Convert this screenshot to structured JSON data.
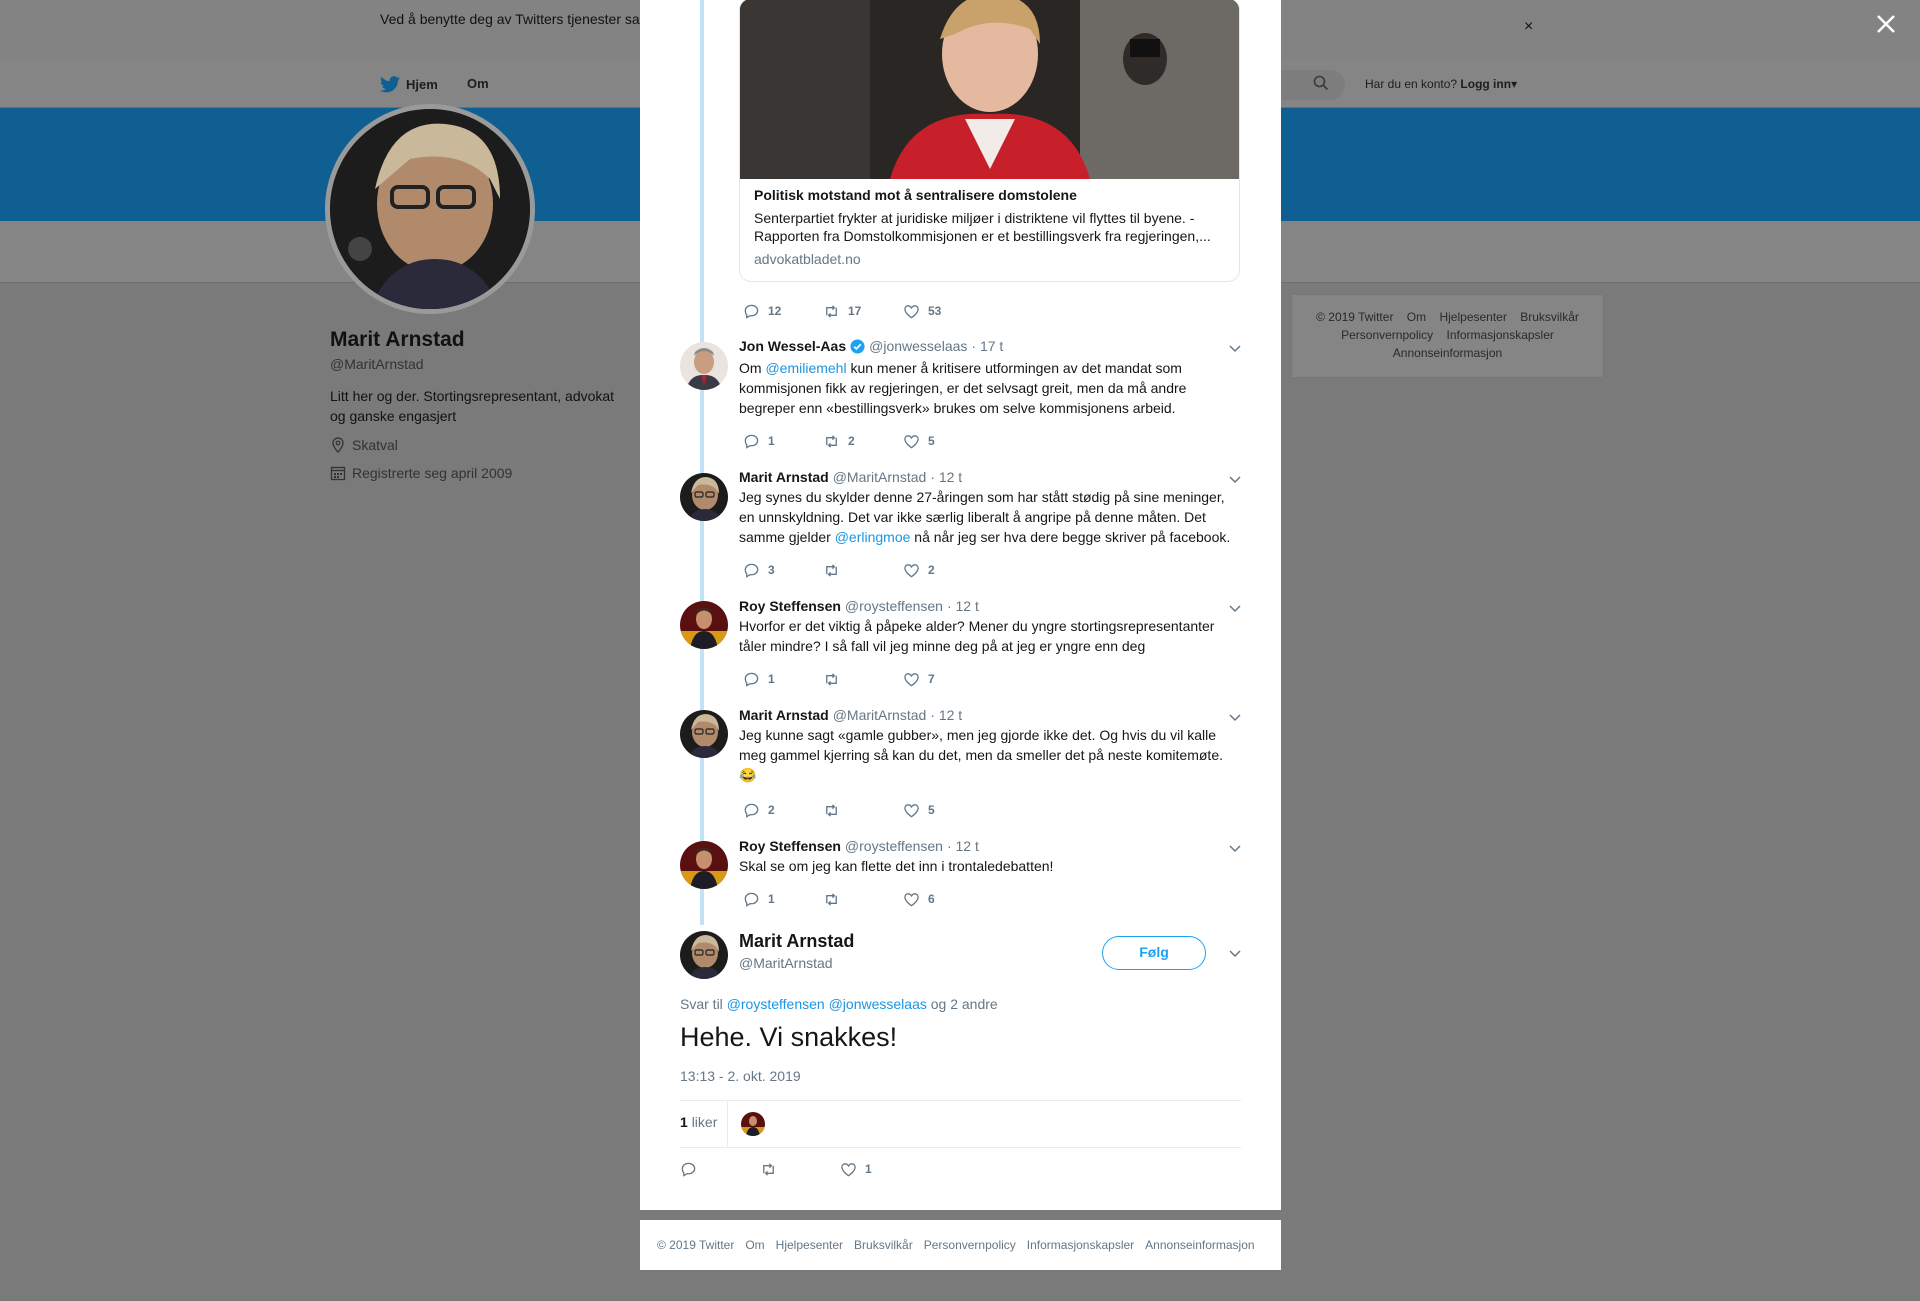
{
  "cookie": {
    "text": "Ved å benytte deg av Twitters tjenester sa… informasjonskapsler til bl.a. analyser, personalisering og annonser.",
    "close": "×"
  },
  "nav": {
    "home": "Hjem",
    "about": "Om",
    "login_prompt": "Har du en konto?",
    "login": "Logg inn"
  },
  "profile": {
    "name": "Marit Arnstad",
    "handle": "@MaritArnstad",
    "bio": "Litt her og der. Stortingsrepresentant, advokat og ganske engasjert",
    "location": "Skatval",
    "joined": "Registrerte seg april 2009"
  },
  "side_footer": {
    "items": [
      "© 2019 Twitter",
      "Om",
      "Hjelpesenter",
      "Bruksvilkår",
      "Personvernpolicy",
      "Informasjonskapsler",
      "Annonseinformasjon"
    ]
  },
  "card": {
    "title": "Politisk motstand mot å sentralisere domstolene",
    "description": "Senterpartiet frykter at juridiske miljøer i distriktene vil flyttes til byene. - Rapporten fra Domstolkommisjonen er et bestillingsverk fra regjeringen,...",
    "domain": "advokatbladet.no"
  },
  "card_actions": {
    "replies": "12",
    "retweets": "17",
    "likes": "53"
  },
  "tweets": [
    {
      "name": "Jon Wessel-Aas",
      "handle": "@jonwesselaas",
      "time": "· 17 t",
      "pre": "Om ",
      "mention": "@emiliemehl",
      "post": " kun mener å kritisere utformingen av det mandat som kommisjonen fikk av regjeringen, er det selvsagt greit, men da må andre begreper enn «bestillingsverk» brukes om selve kommisjonens arbeid.",
      "replies": "1",
      "retweets": "2",
      "likes": "5"
    },
    {
      "name": "Marit Arnstad",
      "handle": "@MaritArnstad",
      "time": "· 12 t",
      "pre": "Jeg synes du skylder denne 27-åringen som har stått stødig på sine meninger, en unnskyldning. Det var ikke særlig liberalt å angripe på denne måten. Det samme gjelder ",
      "mention": "@erlingmoe",
      "post": " nå når jeg ser hva dere begge skriver på facebook.",
      "replies": "3",
      "retweets": "",
      "likes": "2"
    },
    {
      "name": "Roy Steffensen",
      "handle": "@roysteffensen",
      "time": "· 12 t",
      "text": "Hvorfor er det viktig å påpeke alder? Mener du yngre stortingsrepresentanter tåler mindre? I så fall vil jeg minne deg på at jeg er yngre enn deg",
      "replies": "1",
      "retweets": "",
      "likes": "7"
    },
    {
      "name": "Marit Arnstad",
      "handle": "@MaritArnstad",
      "time": "· 12 t",
      "text": "Jeg kunne sagt «gamle gubber», men jeg gjorde ikke det.  Og hvis du vil kalle meg gammel kjerring så kan du det, men da smeller det på neste komitemøte.",
      "emoji": "😂",
      "replies": "2",
      "retweets": "",
      "likes": "5"
    },
    {
      "name": "Roy Steffensen",
      "handle": "@roysteffensen",
      "time": "· 12 t",
      "text": "Skal se om jeg kan flette det inn i trontaledebatten!",
      "replies": "1",
      "retweets": "",
      "likes": "6"
    }
  ],
  "main_tweet": {
    "name": "Marit Arnstad",
    "handle": "@MaritArnstad",
    "follow": "Følg",
    "reply_prefix": "Svar til",
    "reply_mention_1": "@roysteffensen",
    "reply_mention_2": "@jonwesselaas",
    "reply_suffix": "og 2 andre",
    "text": "Hehe. Vi snakkes!",
    "timestamp": "13:13 - 2. okt. 2019",
    "like_count": "1",
    "like_label": "liker",
    "likes": "1"
  },
  "modal_footer": {
    "items": [
      "© 2019 Twitter",
      "Om",
      "Hjelpesenter",
      "Bruksvilkår",
      "Personvernpolicy",
      "Informasjonskapsler",
      "Annonseinformasjon"
    ]
  },
  "colors": {
    "accent": "#1da1f2",
    "link": "#1b95e0",
    "muted": "#657786",
    "thread": "#c4e2f6",
    "banner": "#0f5f92"
  },
  "icons": [
    "twitter-bird-icon",
    "search-icon",
    "location-icon",
    "calendar-icon",
    "reply-icon",
    "retweet-icon",
    "like-icon",
    "chevron-down-icon",
    "close-icon",
    "verified-badge-icon"
  ]
}
